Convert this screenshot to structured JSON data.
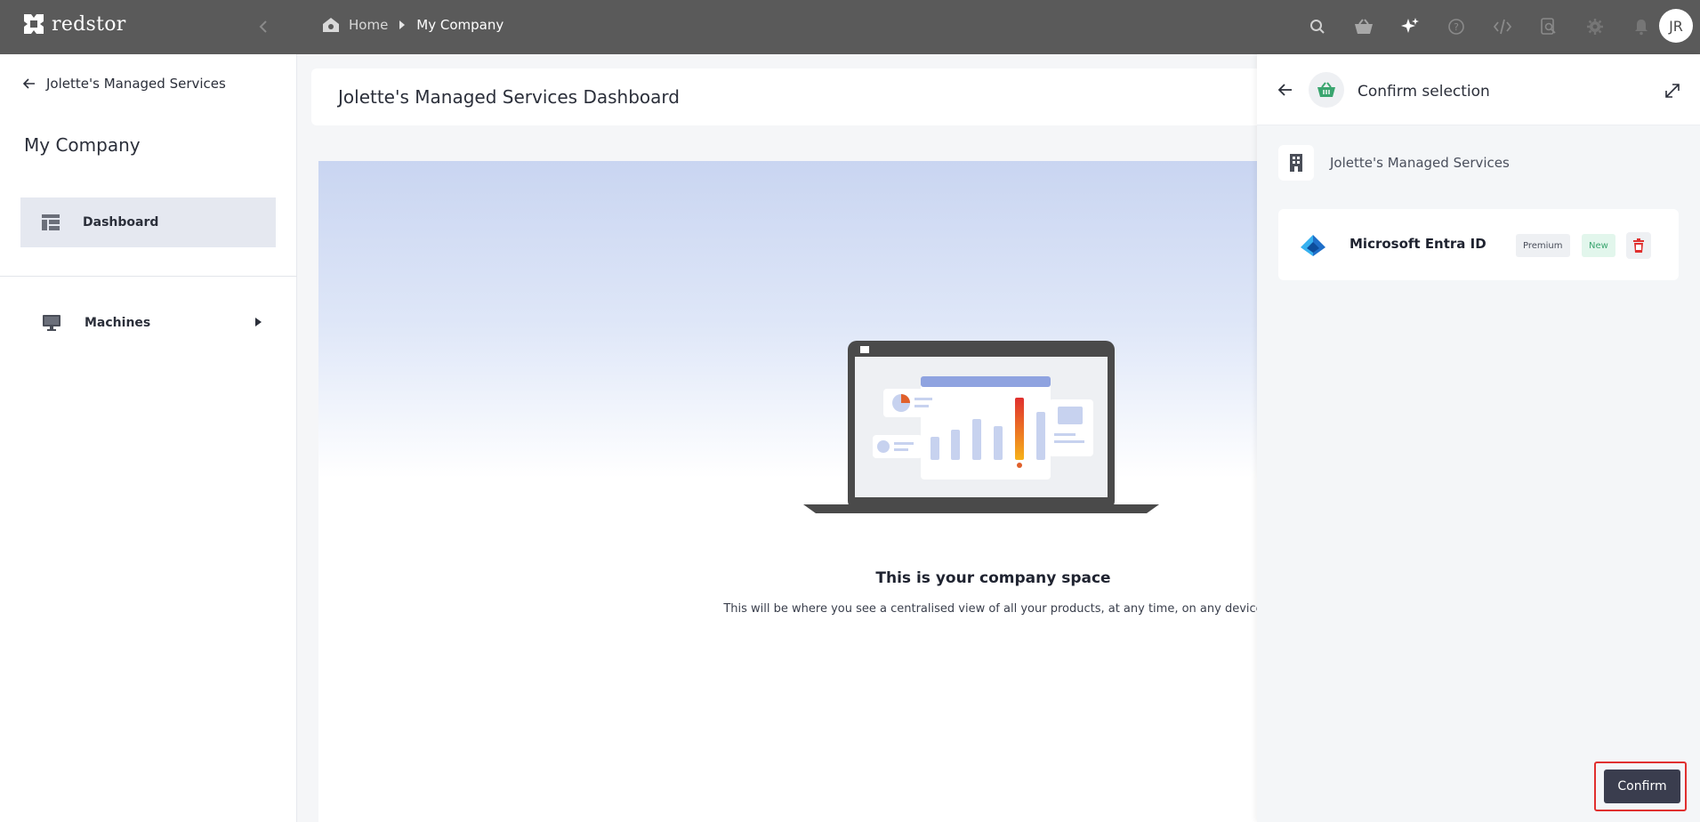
{
  "brand": {
    "name": "redstor"
  },
  "breadcrumb": {
    "home": "Home",
    "current": "My Company"
  },
  "user": {
    "initials": "JR"
  },
  "top_icons": [
    "search-icon",
    "basket-icon",
    "sparkle-icon",
    "help-icon",
    "code-icon",
    "doc-search-icon",
    "gear-icon",
    "bell-icon"
  ],
  "sidebar": {
    "back_label": "Jolette's Managed Services",
    "title": "My Company",
    "items": [
      {
        "label": "Dashboard",
        "icon": "dashboard-icon",
        "active": true
      },
      {
        "label": "Machines",
        "icon": "monitor-icon",
        "active": false
      }
    ]
  },
  "main": {
    "title": "Jolette's Managed Services Dashboard",
    "hero_title": "This is your company space",
    "hero_subtitle": "This will be where you see a centralised view of all your products, at any time, on any device"
  },
  "panel": {
    "title": "Confirm selection",
    "company": "Jolette's Managed Services",
    "product": {
      "name": "Microsoft Entra ID",
      "badge_premium": "Premium",
      "badge_new": "New"
    },
    "confirm_label": "Confirm"
  },
  "colors": {
    "topbar": "#5a5a5a",
    "accent_green": "#3aa56f",
    "danger": "#e0302f",
    "button_dark": "#3a3d4e"
  }
}
